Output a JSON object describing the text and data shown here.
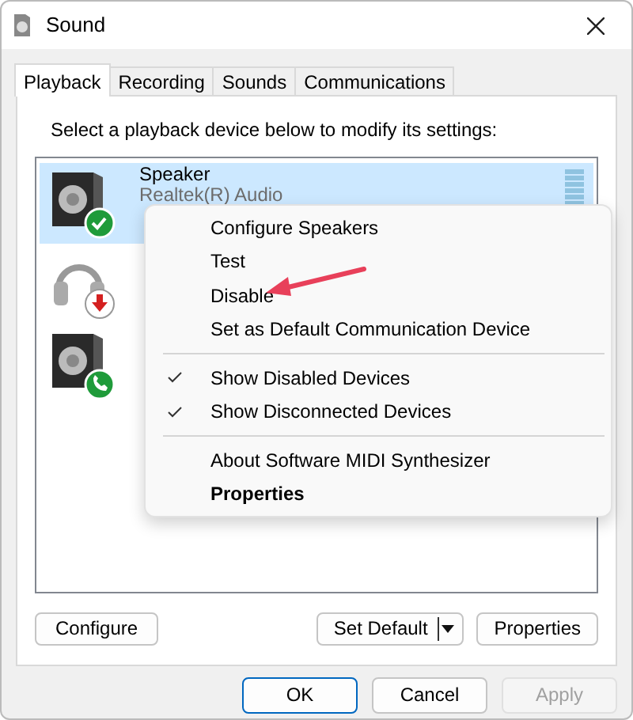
{
  "window": {
    "title": "Sound"
  },
  "tabs": [
    {
      "label": "Playback",
      "selected": true
    },
    {
      "label": "Recording",
      "selected": false
    },
    {
      "label": "Sounds",
      "selected": false
    },
    {
      "label": "Communications",
      "selected": false
    }
  ],
  "instruction": "Select a playback device below to modify its settings:",
  "devices": [
    {
      "kind": "speaker",
      "default": true,
      "unplugged": false,
      "default_communication": false,
      "name": "Speaker",
      "description": "Realtek(R) Audio",
      "selected": true
    },
    {
      "kind": "headphones",
      "default": false,
      "unplugged": true,
      "default_communication": false,
      "selected": false
    },
    {
      "kind": "speaker",
      "default": false,
      "unplugged": false,
      "default_communication": true,
      "selected": false
    }
  ],
  "context_menu": [
    {
      "kind": "item",
      "label": "Configure Speakers",
      "checked": false,
      "bold": false
    },
    {
      "kind": "item",
      "label": "Test",
      "checked": false,
      "bold": false
    },
    {
      "kind": "item",
      "label": "Disable",
      "checked": false,
      "bold": false
    },
    {
      "kind": "item",
      "label": "Set as Default Communication Device",
      "checked": false,
      "bold": false
    },
    {
      "kind": "separator"
    },
    {
      "kind": "item",
      "label": "Show Disabled Devices",
      "checked": true,
      "bold": false
    },
    {
      "kind": "item",
      "label": "Show Disconnected Devices",
      "checked": true,
      "bold": false
    },
    {
      "kind": "separator"
    },
    {
      "kind": "item",
      "label": "About Software MIDI Synthesizer",
      "checked": false,
      "bold": false
    },
    {
      "kind": "item",
      "label": "Properties",
      "checked": false,
      "bold": true
    }
  ],
  "panel_buttons": [
    {
      "kind": "button",
      "label": "Configure"
    },
    {
      "kind": "split",
      "label": "Set Default"
    },
    {
      "kind": "button",
      "label": "Properties"
    }
  ],
  "dialog_buttons": [
    {
      "label": "OK",
      "default": true,
      "disabled": false
    },
    {
      "label": "Cancel",
      "default": false,
      "disabled": false
    },
    {
      "label": "Apply",
      "default": false,
      "disabled": true
    }
  ]
}
